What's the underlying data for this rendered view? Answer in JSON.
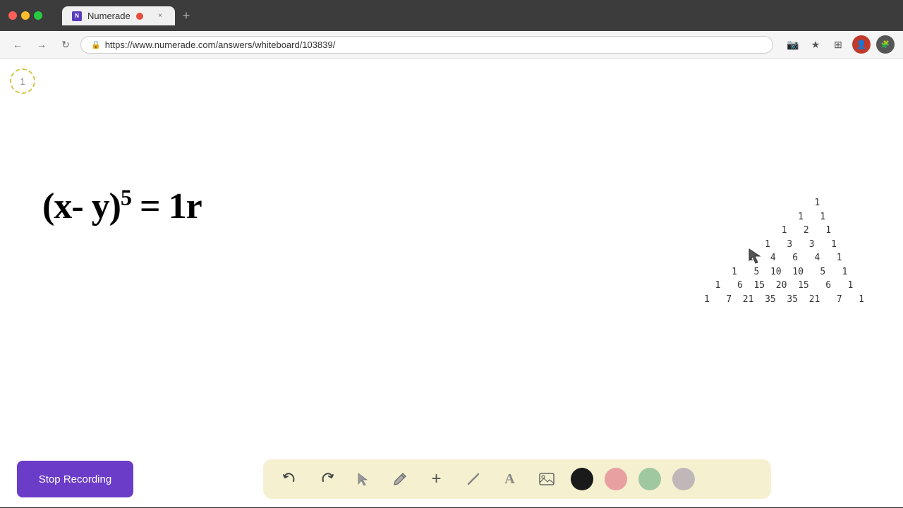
{
  "browser": {
    "tab_label": "Numerade",
    "url": "https://www.numerade.com/answers/whiteboard/103839/",
    "new_tab_symbol": "+",
    "close_symbol": "×"
  },
  "nav": {
    "back": "←",
    "forward": "→",
    "refresh": "↻",
    "lock": "🔒",
    "bookmark": "★",
    "cast": "📺",
    "apps": "⊞"
  },
  "page": {
    "step_number": "1",
    "math_equation": "(x- y)",
    "math_exponent": "5",
    "math_equals": "= 1r"
  },
  "pascal_triangle": {
    "rows": [
      "        1",
      "      1   1",
      "    1   2   1",
      "  1   3   3   1",
      "1   4   6   4   1",
      "1   5  10  10   5   1",
      "1   6  15  20  15   6   1",
      "1   7  21  35  35  21   7   1"
    ]
  },
  "toolbar": {
    "stop_recording_label": "Stop Recording",
    "undo_symbol": "↺",
    "redo_symbol": "↻",
    "select_symbol": "↖",
    "pen_symbol": "✏",
    "add_symbol": "+",
    "eraser_symbol": "/",
    "text_symbol": "A",
    "image_symbol": "🖼",
    "colors": [
      {
        "name": "black",
        "hex": "#1a1a1a"
      },
      {
        "name": "pink",
        "hex": "#e8a0a0"
      },
      {
        "name": "green",
        "hex": "#a0c8a0"
      },
      {
        "name": "gray",
        "hex": "#c0b8b8"
      }
    ]
  },
  "icons": {
    "lock": "🔒",
    "camera": "📷",
    "star": "★",
    "monitor": "🖥",
    "puzzle": "🧩"
  }
}
